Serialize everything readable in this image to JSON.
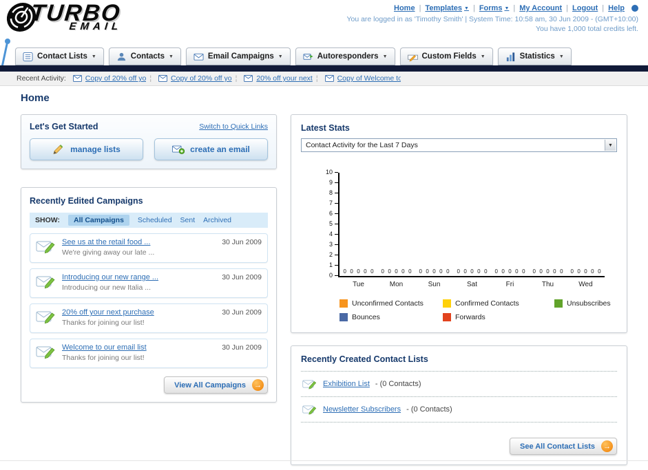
{
  "header": {
    "logo_line1": "TURBO",
    "logo_line2": "EMAIL",
    "nav": [
      {
        "label": "Home",
        "dropdown": false
      },
      {
        "label": "Templates",
        "dropdown": true
      },
      {
        "label": "Forms",
        "dropdown": true
      },
      {
        "label": "My Account",
        "dropdown": false
      },
      {
        "label": "Logout",
        "dropdown": false
      },
      {
        "label": "Help",
        "dropdown": false
      }
    ],
    "login_line": "You are logged in as 'Timothy Smith' | System Time: 10:58 am, 30 Jun 2009 - (GMT+10:00)",
    "credits_line": "You have 1,000 total credits left."
  },
  "main_nav": {
    "tabs": [
      {
        "label": "Contact Lists"
      },
      {
        "label": "Contacts"
      },
      {
        "label": "Email Campaigns"
      },
      {
        "label": "Autoresponders"
      },
      {
        "label": "Custom Fields"
      },
      {
        "label": "Statistics"
      }
    ]
  },
  "recent_activity": {
    "label": "Recent Activity:",
    "items": [
      {
        "text": "Copy of 20% off yo"
      },
      {
        "text": "Copy of 20% off yo"
      },
      {
        "text": "20% off your next"
      },
      {
        "text": "Copy of Welcome to"
      }
    ]
  },
  "page": {
    "title": "Home"
  },
  "get_started": {
    "title": "Let's Get Started",
    "switch_link": "Switch to Quick Links",
    "manage_lists_label": "manage lists",
    "create_email_label": "create an email"
  },
  "campaigns": {
    "title": "Recently Edited Campaigns",
    "show_label": "SHOW:",
    "tabs": [
      {
        "label": "All Campaigns",
        "active": true
      },
      {
        "label": "Scheduled",
        "active": false
      },
      {
        "label": "Sent",
        "active": false
      },
      {
        "label": "Archived",
        "active": false
      }
    ],
    "items": [
      {
        "title": "See us at the retail food ...",
        "subtitle": "We're giving away our late ...",
        "date": "30 Jun 2009"
      },
      {
        "title": "Introducing our new range ...",
        "subtitle": "Introducing our new Italia ...",
        "date": "30 Jun 2009"
      },
      {
        "title": "20% off your next purchase",
        "subtitle": "Thanks for joining our list!",
        "date": "30 Jun 2009"
      },
      {
        "title": "Welcome to our email list",
        "subtitle": "Thanks for joining our list!",
        "date": "30 Jun 2009"
      }
    ],
    "view_all_label": "View All Campaigns"
  },
  "stats": {
    "title": "Latest Stats",
    "filter_value": "Contact Activity for the Last 7 Days",
    "chart_data": {
      "type": "bar",
      "title": "Contact Activity for the Last 7 Days",
      "categories": [
        "Tue",
        "Mon",
        "Sun",
        "Sat",
        "Fri",
        "Thu",
        "Wed"
      ],
      "series": [
        {
          "name": "Unconfirmed Contacts",
          "color": "#f7941d",
          "values": [
            0,
            0,
            0,
            0,
            0,
            0,
            0
          ]
        },
        {
          "name": "Confirmed Contacts",
          "color": "#ffd10a",
          "values": [
            0,
            0,
            0,
            0,
            0,
            0,
            0
          ]
        },
        {
          "name": "Unsubscribes",
          "color": "#61a32a",
          "values": [
            0,
            0,
            0,
            0,
            0,
            0,
            0
          ]
        },
        {
          "name": "Bounces",
          "color": "#4a69a5",
          "values": [
            0,
            0,
            0,
            0,
            0,
            0,
            0
          ]
        },
        {
          "name": "Forwards",
          "color": "#e2431e",
          "values": [
            0,
            0,
            0,
            0,
            0,
            0,
            0
          ]
        }
      ],
      "ylim": [
        0,
        10
      ],
      "ytick_step": 1,
      "grid": false,
      "legend_position": "bottom",
      "value_labels": true
    }
  },
  "contact_lists": {
    "title": "Recently Created Contact Lists",
    "items": [
      {
        "name": "Exhibition List",
        "detail": "- (0 Contacts)"
      },
      {
        "name": "Newsletter Subscribers",
        "detail": "- (0 Contacts)"
      }
    ],
    "see_all_label": "See All Contact Lists"
  }
}
